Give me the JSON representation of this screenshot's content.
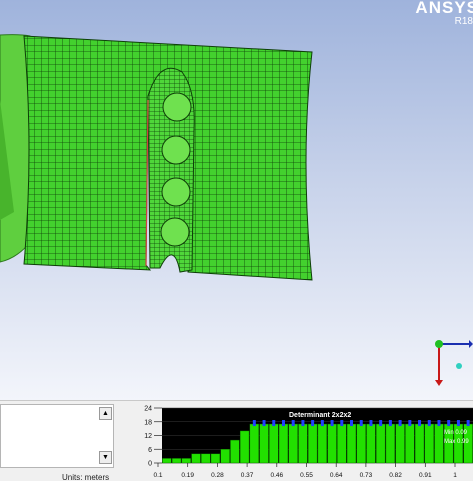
{
  "logo": {
    "name": "ANSYS",
    "release": "R18"
  },
  "units": "Units: meters",
  "colors": {
    "mesh_fill": "#3fcf2b",
    "mesh_line": "#0c3a06",
    "bar": "#22e000",
    "background_top": "#9fb3dc"
  },
  "chart_data": {
    "type": "bar",
    "title": "Determinant 2x2x2",
    "stats": {
      "min": "Min 0.09",
      "max": "Max 0.99"
    },
    "x_ticks": [
      "0.1",
      "0.19",
      "0.28",
      "0.37",
      "0.46",
      "0.55",
      "0.64",
      "0.73",
      "0.82",
      "0.91",
      "1"
    ],
    "y_ticks": [
      "0",
      "6",
      "12",
      "18",
      "24"
    ],
    "ylim": [
      0,
      24
    ],
    "values": [
      2,
      2,
      2,
      4,
      4,
      4,
      6,
      10,
      14,
      17,
      17,
      17,
      17,
      17,
      17,
      17,
      17,
      17,
      17,
      17,
      17,
      17,
      17,
      17,
      17,
      17,
      17,
      17,
      17,
      17,
      17,
      17
    ],
    "grid": true
  }
}
